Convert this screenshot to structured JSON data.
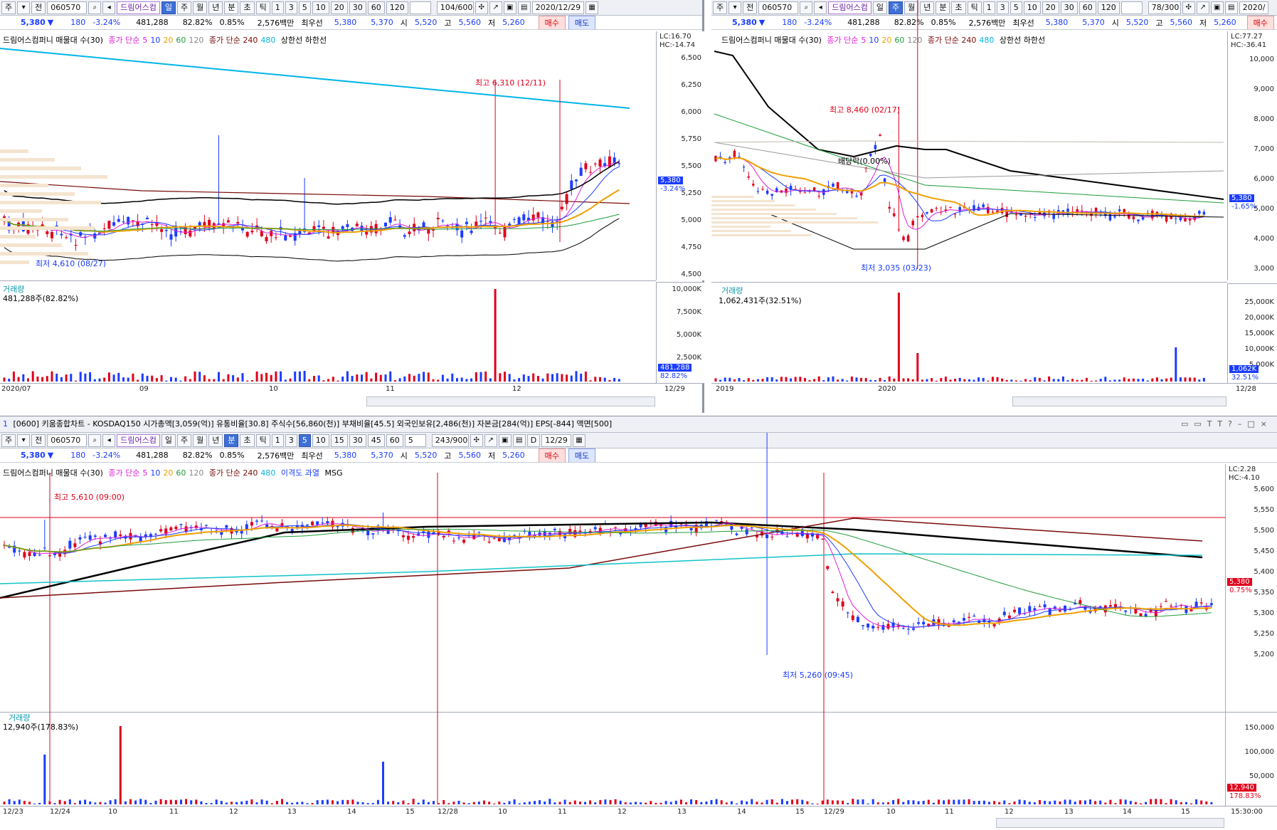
{
  "colors": {
    "up": "#e0001b",
    "down": "#1b3cff",
    "ma5": "#e01fd8",
    "ma10": "#1b3cff",
    "ma20": "#f0a000",
    "ma60": "#1f9c3a",
    "ma120": "#888888",
    "ma240": "#7a0a0a",
    "ma480": "#00b5e8",
    "black": "#000000"
  },
  "toolbar": {
    "market": "주",
    "prev": "전",
    "code": "060570",
    "name": "드림어스컴",
    "periods": [
      "일",
      "주",
      "월",
      "년",
      "분",
      "초",
      "틱"
    ],
    "nums": [
      "1",
      "3",
      "5",
      "10",
      "20",
      "30",
      "60",
      "120"
    ],
    "buy": "매수",
    "sell": "매도"
  },
  "quote": {
    "price": "5,380",
    "arrow": "▼",
    "change": "180",
    "pct": "-3.24%",
    "volume": "481,288",
    "turnover_pct": "82.82%",
    "ratio": "0.85%",
    "amount": "2,576백만",
    "best_label": "최우선",
    "ask": "5,380",
    "bid": "5,370",
    "open_label": "시",
    "open": "5,520",
    "high_label": "고",
    "high": "5,560",
    "low_label": "저",
    "low": "5,260"
  },
  "legend": {
    "name": "드림어스컴퍼니 매물대 수(30)",
    "ma_label": "종가 단순",
    "ma_nums": [
      "5",
      "10",
      "20",
      "60",
      "120"
    ],
    "ma_label2": "종가 단순 240",
    "ma480": "480",
    "bands": "상한선 하한선",
    "disp": "이격도 과열",
    "msg": "MSG"
  },
  "left": {
    "count": "104/600",
    "date": "2020/12/29",
    "lc": "LC:16.70",
    "hc": "HC:-14.74",
    "price_tag": "5,380",
    "pct_tag": "-3.24%",
    "yticks": [
      "6,500",
      "6,250",
      "6,000",
      "5,750",
      "5,500",
      "5,250",
      "5,000",
      "4,750",
      "4,500"
    ],
    "hi_ann": "최고 6,310 (12/11)",
    "lo_ann": "최저 4,610 (08/27)",
    "vol_title": "거래량",
    "vol_val": "481,288주(82.82%)",
    "vticks": [
      "10,000K",
      "7,500K",
      "5,000K",
      "2,500K"
    ],
    "vol_tag": "481,288",
    "vol_tag2": "82.82%",
    "xlabels": [
      "2020/07",
      "09",
      "10",
      "11",
      "12",
      "12/29"
    ]
  },
  "right": {
    "count": "78/300",
    "date": "2020/",
    "lc": "LC:77.27",
    "hc": "HC:-36.41",
    "price_tag": "5,380",
    "pct_tag": "-1.65%",
    "yticks": [
      "10,000",
      "9,000",
      "8,000",
      "7,000",
      "6,000",
      "5,000",
      "4,000",
      "3,000"
    ],
    "hi_ann": "최고 8,460 (02/17)",
    "div_ann": "배당락(0.00%)",
    "lo_ann": "최저 3,035 (03/23)",
    "vol_title": "거래량",
    "vol_val": "1,062,431주(32.51%)",
    "vticks": [
      "25,000K",
      "20,000K",
      "15,000K",
      "10,000K",
      "5,000K"
    ],
    "vol_tag": "1,062K",
    "vol_tag2": "32.51%",
    "xlabels": [
      "2019",
      "2020",
      "12/28"
    ]
  },
  "bottom": {
    "title": "[0600] 키움종합차트 - KOSDAQ150 시가총액[3,059(억)] 유통비율[30.8] 주식수[56,860(천)] 부채비율[45.5] 외국인보유[2,486(천)] 자본금[284(억)] EPS[-844] 액면[500]",
    "title_tab": "1",
    "min_nums": [
      "1",
      "3",
      "5",
      "10",
      "15",
      "30",
      "45",
      "60"
    ],
    "sel_min": "5",
    "tick_sel": "5",
    "count": "243/900",
    "date": "12/29",
    "d_label": "D",
    "lc": "LC:2.28",
    "hc": "HC:-4.10",
    "price_tag": "5,380",
    "pct_tag": "0.75%",
    "pct_tag2": "178.83%",
    "yticks": [
      "5,600",
      "5,550",
      "5,500",
      "5,450",
      "5,400",
      "5,350",
      "5,300",
      "5,250",
      "5,200"
    ],
    "hi_ann": "최고 5,610 (09:00)",
    "lo_ann": "최저 5,260 (09:45)",
    "vol_title": "거래량",
    "vol_val": "12,940주(178.83%)",
    "vticks": [
      "150,000",
      "100,000",
      "50,000"
    ],
    "vol_tag": "12,940",
    "xlabels": [
      "12/23",
      "12/24",
      "10",
      "11",
      "12",
      "13",
      "14",
      "15",
      "12/28",
      "10",
      "11",
      "12",
      "13",
      "14",
      "15",
      "12/29",
      "10",
      "11",
      "12",
      "13",
      "14",
      "15"
    ],
    "end_time": "15:30:00"
  },
  "icons": {
    "scroll": [
      "◀",
      "▶",
      "◀◀",
      "■",
      "▶▶",
      "-",
      "+",
      "A"
    ]
  }
}
